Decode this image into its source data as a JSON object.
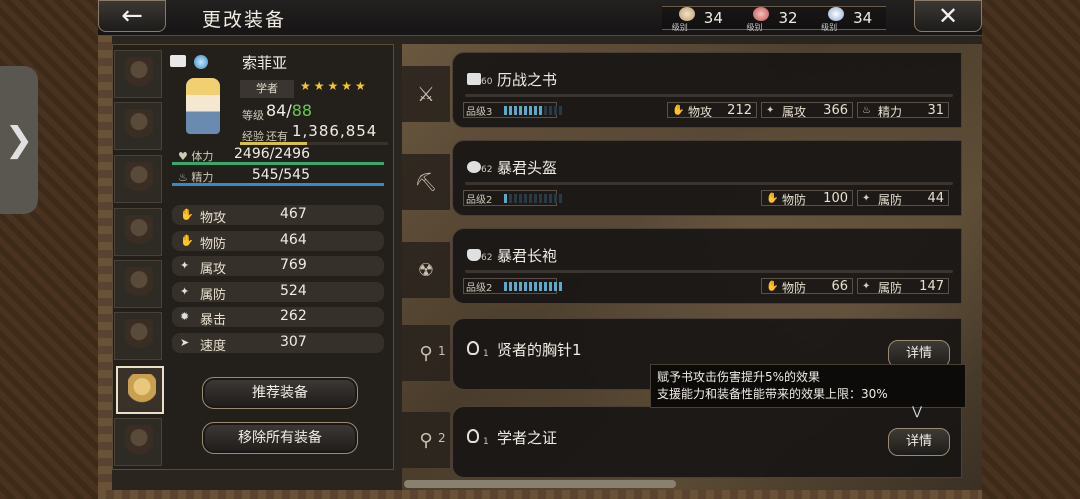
{
  "header": {
    "title": "更改装备",
    "back_icon": "back-arrow-icon",
    "close_icon": "close-icon"
  },
  "currency": [
    {
      "label": "级别",
      "value": "34",
      "color": "#d8c0a0"
    },
    {
      "label": "级别",
      "value": "32",
      "color": "#e07070"
    },
    {
      "label": "级别",
      "value": "34",
      "color": "#c8d8f0"
    }
  ],
  "character": {
    "name": "索菲亚",
    "job": "学者",
    "stars": "★★★★★",
    "level_label": "等级",
    "level": "84",
    "level_sep": "/",
    "level_max": "88",
    "exp_label": "经验",
    "exp_remaining_label": "还有",
    "exp_value": "1,386,854",
    "exp_progress": 0.45,
    "hp_label": "体力",
    "hp": "2496/2496",
    "sp_label": "精力",
    "sp": "545/545"
  },
  "stats": [
    {
      "label": "物攻",
      "value": "467",
      "icon": "p-atk-icon"
    },
    {
      "label": "物防",
      "value": "464",
      "icon": "p-def-icon"
    },
    {
      "label": "属攻",
      "value": "769",
      "icon": "e-atk-icon"
    },
    {
      "label": "属防",
      "value": "524",
      "icon": "e-def-icon"
    },
    {
      "label": "暴击",
      "value": "262",
      "icon": "crit-icon"
    },
    {
      "label": "速度",
      "value": "307",
      "icon": "speed-icon"
    }
  ],
  "buttons": {
    "recommend": "推荐装备",
    "remove_all": "移除所有装备",
    "details": "详情"
  },
  "equipment": [
    {
      "slot_icon": "weapon-slot-icon",
      "level": "60",
      "name": "历战之书",
      "grade_label": "品级",
      "grade": "3",
      "stats": [
        {
          "label": "物攻",
          "value": "212"
        },
        {
          "label": "属攻",
          "value": "366"
        },
        {
          "label": "精力",
          "value": "31"
        }
      ]
    },
    {
      "slot_icon": "helmet-slot-icon",
      "level": "62",
      "name": "暴君头盔",
      "grade_label": "品级",
      "grade": "2",
      "stats": [
        {
          "label": "物防",
          "value": "100"
        },
        {
          "label": "属防",
          "value": "44"
        }
      ]
    },
    {
      "slot_icon": "armor-slot-icon",
      "level": "62",
      "name": "暴君长袍",
      "grade_label": "品级",
      "grade": "2",
      "stats": [
        {
          "label": "物防",
          "value": "66"
        },
        {
          "label": "属防",
          "value": "147"
        }
      ]
    }
  ],
  "accessories": [
    {
      "slot": "1",
      "level": "1",
      "name": "贤者的胸针1"
    },
    {
      "slot": "2",
      "level": "1",
      "name": "学者之证"
    }
  ],
  "tooltip": {
    "line1": "赋予书攻击伤害提升5%的效果",
    "line2": "支援能力和装备性能带来的效果上限：30%"
  }
}
